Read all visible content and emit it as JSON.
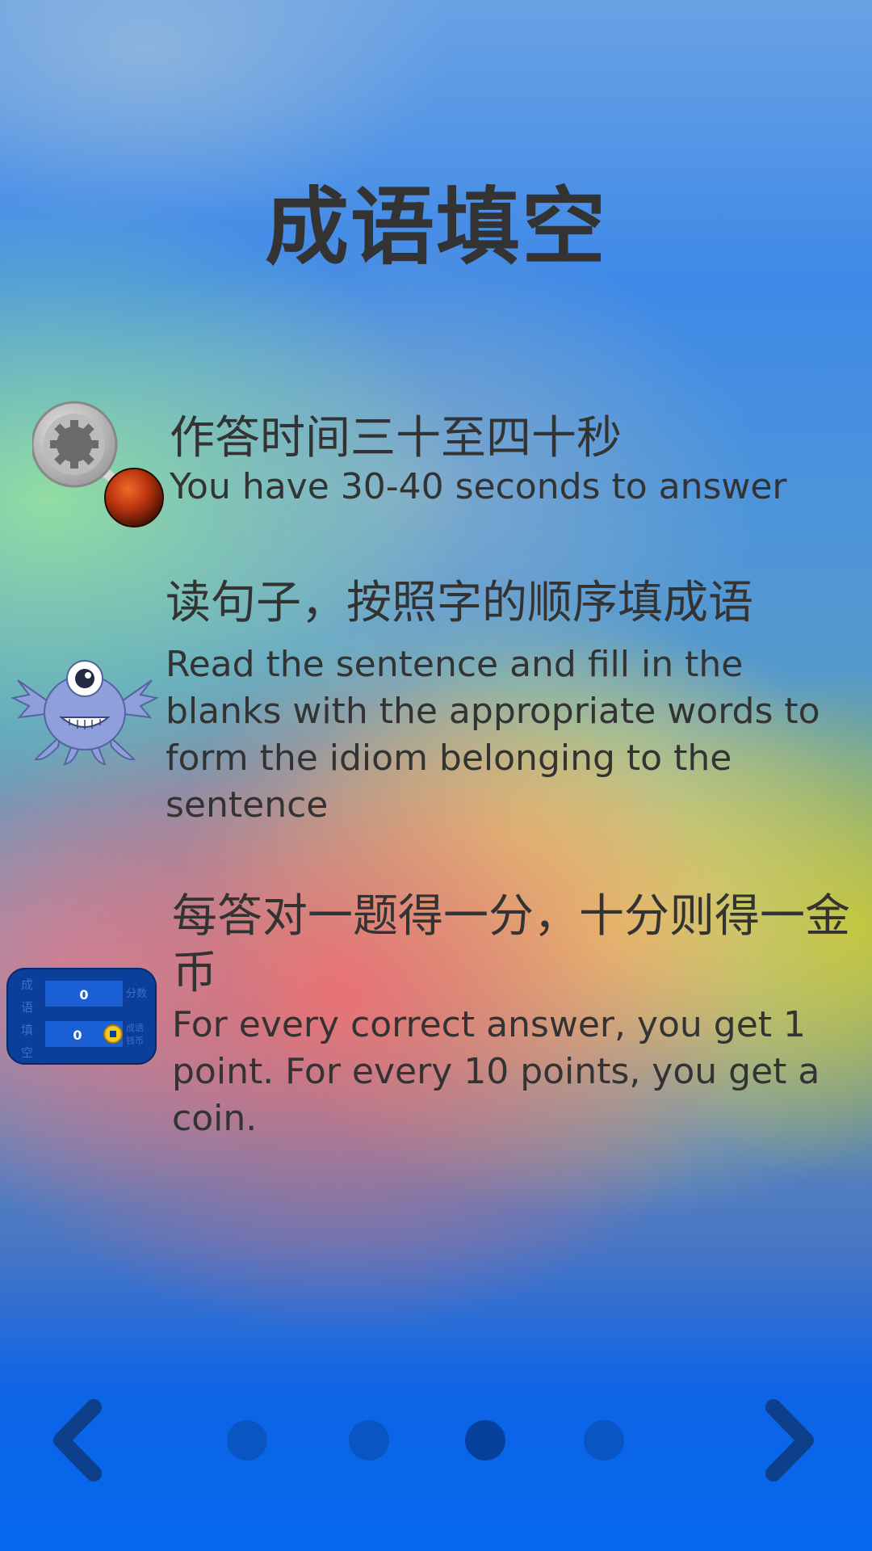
{
  "header": {
    "title": "成语填空"
  },
  "instructions": [
    {
      "icon": "timer-bomb-icon",
      "zh": "作答时间三十至四十秒",
      "en": "You have 30-40 seconds to answer"
    },
    {
      "icon": "monster-mascot-icon",
      "zh": "读句子，按照字的顺序填成语",
      "en": "Read the sentence and fill in the blanks with the appropriate words to form the idiom belonging to the sentence"
    },
    {
      "icon": "score-panel-icon",
      "zh": "每答对一题得一分，十分则得一金币",
      "en": "For every correct answer, you get 1 point. For every 10 points, you get a coin."
    }
  ],
  "score_panel": {
    "side_label": "成语填空",
    "score_label": "分数",
    "coin_label": "成语钱币",
    "score_value": "0",
    "coin_value": "0"
  },
  "navigation": {
    "prev_icon": "chevron-left-icon",
    "next_icon": "chevron-right-icon",
    "page_count": 4,
    "active_page": 3
  },
  "colors": {
    "text": "#333333",
    "dot": "#0a55c4",
    "dot_active": "#063f9c",
    "arrow": "#0d3f8a"
  }
}
